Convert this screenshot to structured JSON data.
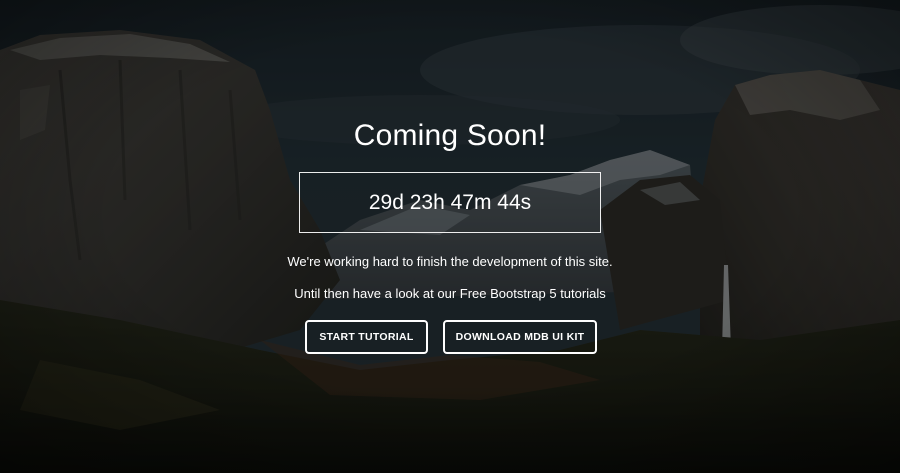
{
  "hero": {
    "title": "Coming Soon!",
    "countdown": "29d 23h 47m 44s",
    "message_line1": "We're working hard to finish the development of this site.",
    "message_line2": "Until then have a look at our Free Bootstrap 5 tutorials"
  },
  "buttons": {
    "start_tutorial": "START TUTORIAL",
    "download_kit": "DOWNLOAD MDB UI KIT"
  },
  "colors": {
    "text": "#ffffff",
    "overlay": "#000000"
  },
  "background": {
    "icon": "mountain-valley-photo"
  }
}
